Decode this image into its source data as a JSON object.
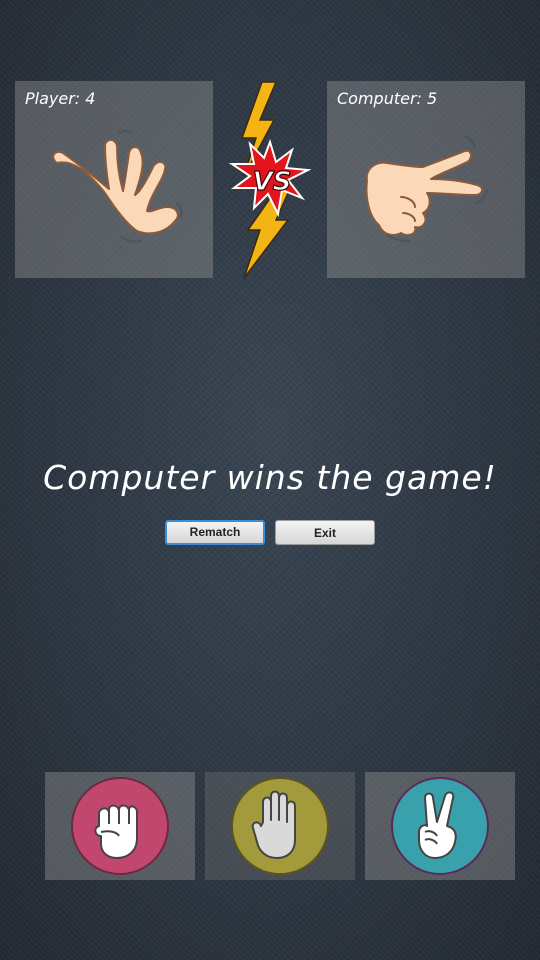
{
  "scoreboard": {
    "player_label": "Player: 4",
    "computer_label": "Computer: 5",
    "player_hand": "paper-hand-icon",
    "computer_hand": "scissors-hand-icon"
  },
  "result": {
    "message": "Computer wins the game!"
  },
  "buttons": {
    "rematch": "Rematch",
    "exit": "Exit"
  },
  "choices": [
    {
      "name": "rock",
      "icon": "fist-icon",
      "color": "#c2476f"
    },
    {
      "name": "paper",
      "icon": "open-palm-icon",
      "color": "#a39a3b"
    },
    {
      "name": "scissors",
      "icon": "peace-sign-icon",
      "color": "#39a1ac"
    }
  ],
  "colors": {
    "skin": "#fbd8b7",
    "lightning": "#f4b413",
    "vs_burst": "#e3141b"
  }
}
